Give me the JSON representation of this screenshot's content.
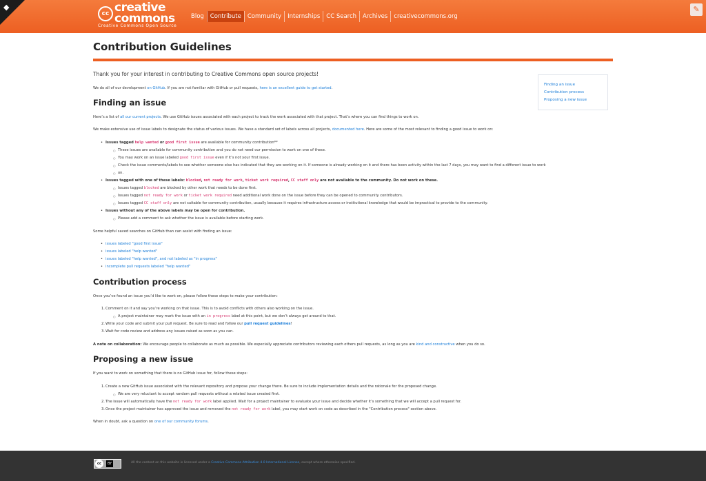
{
  "header": {
    "logo_cc": "cc",
    "logo_word": "creative commons",
    "logo_tag": "Creative Commons Open Source",
    "nav": [
      {
        "label": "Blog",
        "active": false
      },
      {
        "label": "Contribute",
        "active": true
      },
      {
        "label": "Community",
        "active": false
      },
      {
        "label": "Internships",
        "active": false
      },
      {
        "label": "CC Search",
        "active": false
      },
      {
        "label": "Archives",
        "active": false
      },
      {
        "label": "creativecommons.org",
        "active": false
      }
    ],
    "edit_icon": "pencil-icon",
    "corner_icon": "github-octocat-icon"
  },
  "page": {
    "title": "Contribution Guidelines",
    "intro": "Thank you for your interest in contributing to Creative Commons open source projects!",
    "dev_p": {
      "t1": "We do all of our development ",
      "l1": "on GitHub",
      "t2": ". If you are not familiar with GitHub or pull requests, ",
      "l2": "here is an excellent guide to get started",
      "t3": "."
    }
  },
  "toc": [
    "Finding an issue",
    "Contribution process",
    "Proposing a new issue"
  ],
  "finding": {
    "heading": "Finding an issue",
    "p1": {
      "t1": "Here’s a list of ",
      "l1": "all our current projects",
      "t2": ". We use GitHub issues associated with each project to track the work associated with that project. That’s where you can find things to work on."
    },
    "p2": {
      "t1": "We make extensive use of issue labels to designate the status of various issues. We have a standard set of labels across all projects, ",
      "l1": "documented here",
      "t2": ". Here are some of the most relevant to finding a good issue to work on:"
    },
    "b1": {
      "t1": "Issues tagged ",
      "c1": "help wanted",
      "t2": " or ",
      "c2": "good first issue",
      "t3": " are available for community contribution**"
    },
    "b1s1": "These issues are available for community contribution and you do not need our permission to work on one of these.",
    "b1s2": {
      "t1": "You may work on an issue labeled ",
      "c1": "good first issue",
      "t2": " even if it’s not your first issue."
    },
    "b1s3a": "Check the issue comments/labels to see whether someone else has indicated that they are working on it. If someone is already working on it and there has been activity within the last 7 days, you may want to find a different issue to work",
    "b1s3b": "on.",
    "b2": {
      "t1": "Issues tagged with one of these labels: ",
      "c1": "blocked",
      "t2": ", ",
      "c2": "not ready for work",
      "t3": ", ",
      "c3": "ticket work required",
      "t4": ", ",
      "c4": "CC staff only",
      "t5": " are not available to the community. Do not work on these."
    },
    "b2s1": {
      "t1": "Issues tagged ",
      "c1": "blocked",
      "t2": " are blocked by other work that needs to be done first."
    },
    "b2s2": {
      "t1": "Issues tagged ",
      "c1": "not ready for work",
      "t2": " or ",
      "c2": "ticket work required",
      "t3": " need additional work done on the issue before they can be opened to community contributors."
    },
    "b2s3": {
      "t1": "Issues tagged ",
      "c1": "CC staff only",
      "t2": " are not suitable for community contribution, usually because it requires infrastructure access or institutional knowledge that would be impractical to provide to the community."
    },
    "b3": {
      "t1": "Issues without any of the above labels ",
      "em": "may",
      "t2": " be open for contribution."
    },
    "b3s1": "Please add a comment to ask whether the issue is available before starting work.",
    "p3": "Some helpful saved searches on GitHub than can assist with finding an issue:",
    "searches": [
      "issues labeled \"good first issue\"",
      "issues labeled \"help wanted\"",
      "issues labeled \"help wanted\", and not labeled as \"in progress\"",
      "incomplete pull requests labeled \"help wanted\""
    ]
  },
  "process": {
    "heading": "Contribution process",
    "p1": "Once you’ve found an issue you’d like to work on, please follow these steps to make your contribution:",
    "s1": "Comment on it and say you’re working on that issue. This is to avoid conflicts with others also working on the issue.",
    "s1a": {
      "t1": "A project maintainer may mark the issue with an ",
      "c1": "in progress",
      "t2": " label at this point, but we don’t always get around to that."
    },
    "s2": {
      "t1": "Write your code and submit your pull request. Be sure to read and follow our ",
      "l1": "pull request guidelines",
      "t2": "!"
    },
    "s3": "Wait for code review and address any issues raised as soon as you can.",
    "note": {
      "b": "A note on collaboration:",
      "t1": " We encourage people to collaborate as much as possible. We especially appreciate contributors reviewing each others pull requests, as long as you are ",
      "l1": "kind and constructive",
      "t2": " when you do so."
    }
  },
  "proposing": {
    "heading": "Proposing a new issue",
    "p1": "If you want to work on something that there is no GitHub issue for, follow these steps:",
    "s1": "Create a new GitHub issue associated with the relevant repository and propose your change there. Be sure to include implementation details and the rationale for the proposed change.",
    "s1a": "We are very reluctant to accept random pull requests without a related issue created first.",
    "s2": {
      "t1": "The issue will automatically have the ",
      "c1": "not ready for work",
      "t2": " label applied. Wait for a project maintainer to evaluate your issue and decide whether it’s something that we will accept a pull request for."
    },
    "s3": {
      "t1": "Once the project maintainer has approved the issue and removed the ",
      "c1": "not ready for work",
      "t2": " label, you may start work on code as described in the \"Contribution process\" section above."
    },
    "p2": {
      "t1": "When in doubt, ask a question on ",
      "l1": "one of our community forums",
      "t2": "."
    }
  },
  "footer": {
    "badge_cc": "cc",
    "badge_by": "BY",
    "t1": "All the content on this website is licensed under a ",
    "l1": "Creative Commons Attribution 4.0 International License",
    "t2": ", except where otherwise specified."
  }
}
